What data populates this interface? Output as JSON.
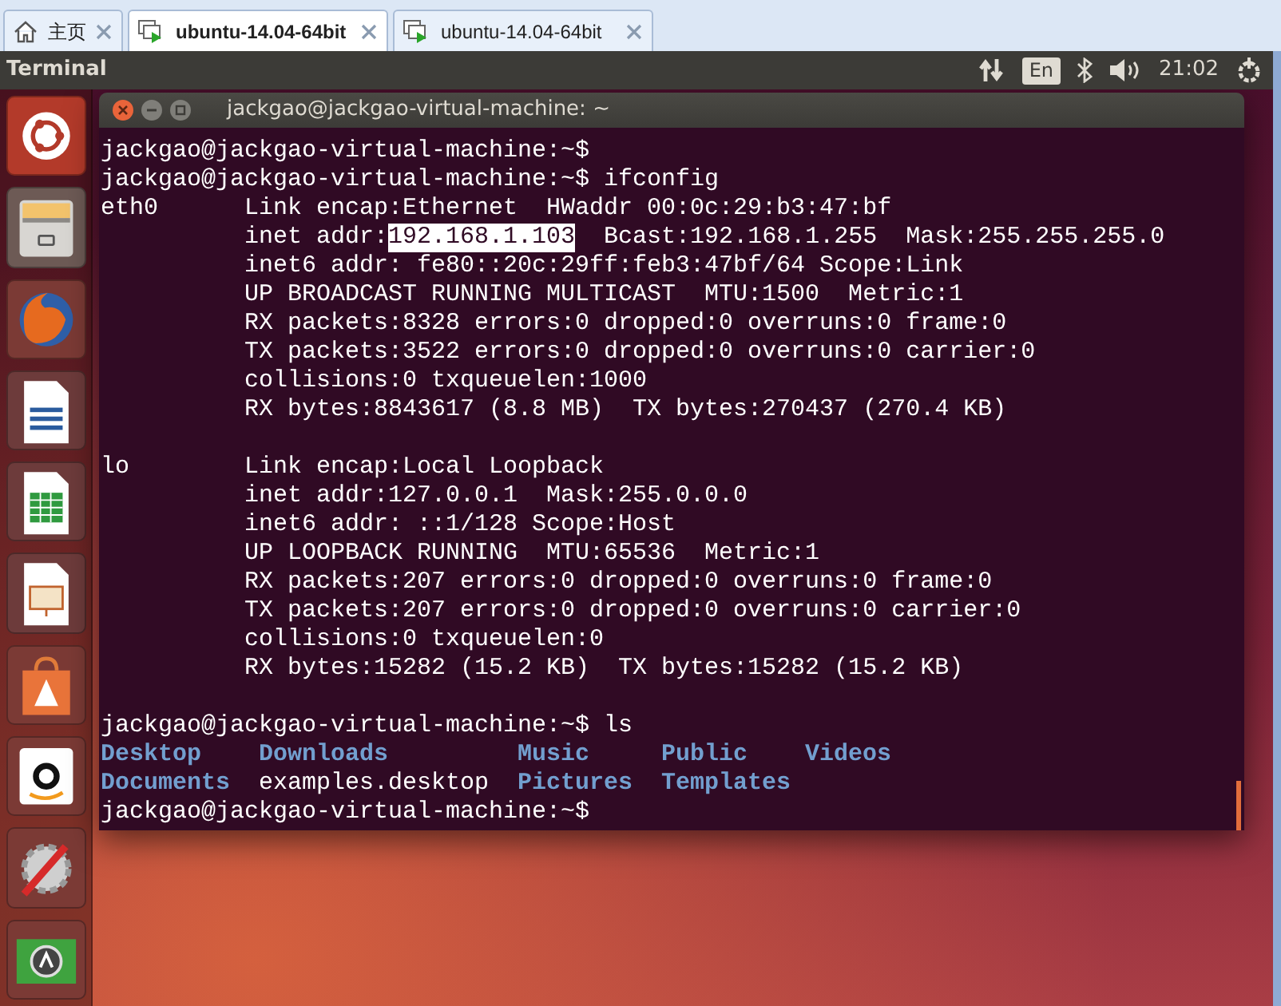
{
  "tabs": [
    {
      "label": "主页",
      "selected": false
    },
    {
      "label": "ubuntu-14.04-64bit",
      "selected": true
    },
    {
      "label": "ubuntu-14.04-64bit",
      "selected": false
    }
  ],
  "panel": {
    "app_title": "Terminal",
    "keyboard_layout": "En",
    "clock": "21:02"
  },
  "launcher": {
    "items": [
      {
        "kind": "dash"
      },
      {
        "kind": "files"
      },
      {
        "kind": "browser"
      },
      {
        "kind": "writer"
      },
      {
        "kind": "calc"
      },
      {
        "kind": "impress"
      },
      {
        "kind": "store"
      },
      {
        "kind": "shop"
      },
      {
        "kind": "settings"
      },
      {
        "kind": "updater"
      }
    ]
  },
  "terminal": {
    "title": "jackgao@jackgao-virtual-machine: ~",
    "lines": [
      {
        "kind": "text",
        "segments": [
          {
            "kind": "plain",
            "text": "jackgao@jackgao-virtual-machine:~$"
          }
        ]
      },
      {
        "kind": "text",
        "segments": [
          {
            "kind": "plain",
            "text": "jackgao@jackgao-virtual-machine:~$ ifconfig"
          }
        ]
      },
      {
        "kind": "detail",
        "name": "eth0",
        "segments": [
          {
            "kind": "plain",
            "text": "Link encap:Ethernet  HWaddr 00:0c:29:b3:47:bf"
          }
        ]
      },
      {
        "kind": "detail",
        "segments": [
          {
            "kind": "plain",
            "text": "inet addr:"
          },
          {
            "kind": "selected",
            "text": "192.168.1.103"
          },
          {
            "kind": "plain",
            "text": "  Bcast:192.168.1.255  Mask:255.255.255.0"
          }
        ]
      },
      {
        "kind": "detail",
        "segments": [
          {
            "kind": "plain",
            "text": "inet6 addr: fe80::20c:29ff:feb3:47bf/64 Scope:Link"
          }
        ]
      },
      {
        "kind": "detail",
        "segments": [
          {
            "kind": "plain",
            "text": "UP BROADCAST RUNNING MULTICAST  MTU:1500  Metric:1"
          }
        ]
      },
      {
        "kind": "detail",
        "segments": [
          {
            "kind": "plain",
            "text": "RX packets:8328 errors:0 dropped:0 overruns:0 frame:0"
          }
        ]
      },
      {
        "kind": "detail",
        "segments": [
          {
            "kind": "plain",
            "text": "TX packets:3522 errors:0 dropped:0 overruns:0 carrier:0"
          }
        ]
      },
      {
        "kind": "detail",
        "segments": [
          {
            "kind": "plain",
            "text": "collisions:0 txqueuelen:1000"
          }
        ]
      },
      {
        "kind": "detail",
        "segments": [
          {
            "kind": "plain",
            "text": "RX bytes:8843617 (8.8 MB)  TX bytes:270437 (270.4 KB)"
          }
        ]
      },
      {
        "kind": "blank"
      },
      {
        "kind": "detail",
        "name": "lo",
        "segments": [
          {
            "kind": "plain",
            "text": "Link encap:Local Loopback"
          }
        ]
      },
      {
        "kind": "detail",
        "segments": [
          {
            "kind": "plain",
            "text": "inet addr:127.0.0.1  Mask:255.0.0.0"
          }
        ]
      },
      {
        "kind": "detail",
        "segments": [
          {
            "kind": "plain",
            "text": "inet6 addr: ::1/128 Scope:Host"
          }
        ]
      },
      {
        "kind": "detail",
        "segments": [
          {
            "kind": "plain",
            "text": "UP LOOPBACK RUNNING  MTU:65536  Metric:1"
          }
        ]
      },
      {
        "kind": "detail",
        "segments": [
          {
            "kind": "plain",
            "text": "RX packets:207 errors:0 dropped:0 overruns:0 frame:0"
          }
        ]
      },
      {
        "kind": "detail",
        "segments": [
          {
            "kind": "plain",
            "text": "TX packets:207 errors:0 dropped:0 overruns:0 carrier:0"
          }
        ]
      },
      {
        "kind": "detail",
        "segments": [
          {
            "kind": "plain",
            "text": "collisions:0 txqueuelen:0"
          }
        ]
      },
      {
        "kind": "detail",
        "segments": [
          {
            "kind": "plain",
            "text": "RX bytes:15282 (15.2 KB)  TX bytes:15282 (15.2 KB)"
          }
        ]
      },
      {
        "kind": "blank"
      },
      {
        "kind": "text",
        "segments": [
          {
            "kind": "plain",
            "text": "jackgao@jackgao-virtual-machine:~$ ls"
          }
        ]
      },
      {
        "kind": "listing",
        "items": [
          {
            "kind": "dir",
            "text": "Desktop"
          },
          {
            "kind": "dir",
            "text": "Downloads"
          },
          {
            "kind": "dir",
            "text": "Music"
          },
          {
            "kind": "dir",
            "text": "Public"
          },
          {
            "kind": "dir",
            "text": "Videos"
          }
        ]
      },
      {
        "kind": "listing",
        "items": [
          {
            "kind": "dir",
            "text": "Documents"
          },
          {
            "kind": "file",
            "text": "examples.desktop"
          },
          {
            "kind": "dir",
            "text": "Pictures"
          },
          {
            "kind": "dir",
            "text": "Templates"
          }
        ]
      },
      {
        "kind": "text",
        "segments": [
          {
            "kind": "plain",
            "text": "jackgao@jackgao-virtual-machine:~$"
          }
        ]
      }
    ]
  }
}
